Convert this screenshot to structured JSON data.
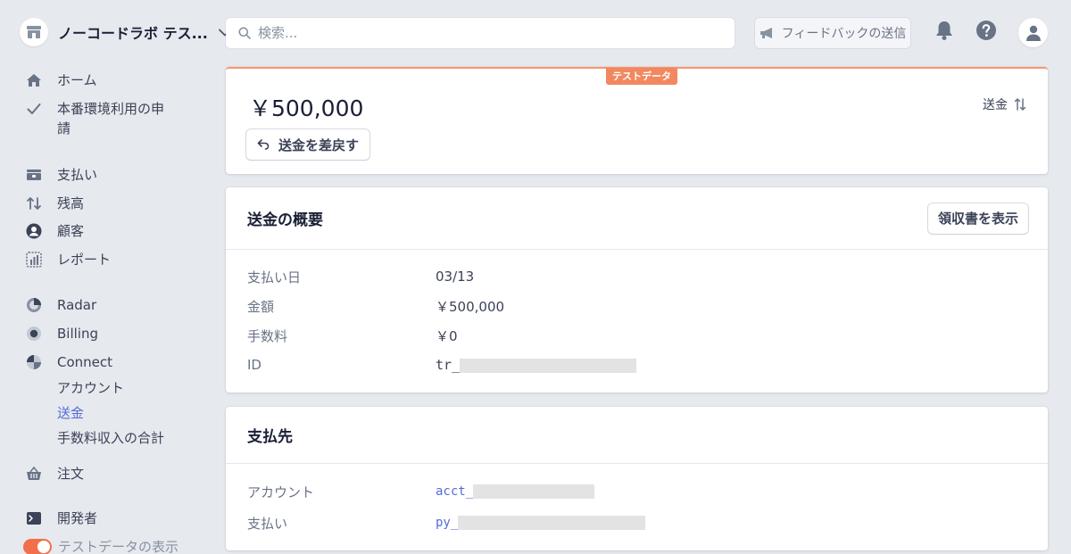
{
  "account": {
    "name": "ノーコードラボ テス..."
  },
  "search": {
    "placeholder": "検索..."
  },
  "feedback": {
    "label": "フィードバックの送信"
  },
  "sidebar": {
    "home": "ホーム",
    "activation": "本番環境利用の申",
    "activation_line2": "請",
    "payments": "支払い",
    "balances": "残高",
    "customers": "顧客",
    "reports": "レポート",
    "radar": "Radar",
    "billing": "Billing",
    "connect": "Connect",
    "connect_accounts": "アカウント",
    "connect_transfers": "送金",
    "connect_fees": "手数料収入の合計",
    "orders": "注文",
    "developers": "開発者",
    "test_data_toggle": "テストデータの表示"
  },
  "transfer": {
    "test_badge": "テストデータ",
    "amount": "￥500,000",
    "type_label": "送金",
    "reverse_button": "送金を差戻す"
  },
  "summary": {
    "title": "送金の概要",
    "receipt_button": "領収書を表示",
    "rows": [
      {
        "label": "支払い日",
        "value": "03/13"
      },
      {
        "label": "金額",
        "value": "￥500,000"
      },
      {
        "label": "手数料",
        "value": "￥0"
      },
      {
        "label": "ID",
        "value": "tr_"
      }
    ]
  },
  "destination": {
    "title": "支払先",
    "rows": [
      {
        "label": "アカウント",
        "value": "acct_"
      },
      {
        "label": "支払い",
        "value": "py_"
      }
    ]
  },
  "colors": {
    "accent": "#556cd6",
    "test_orange": "#f2885f",
    "background": "#e6e9ee"
  }
}
